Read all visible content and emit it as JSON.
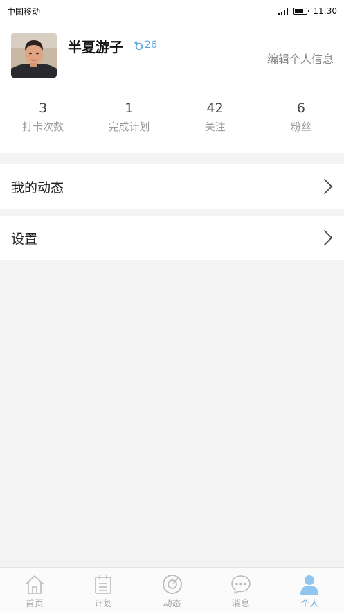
{
  "status_bar": {
    "carrier": "中国移动",
    "time": "11:30"
  },
  "profile": {
    "name": "半夏游子",
    "level": "26",
    "edit_label": "编辑个人信息",
    "stats": [
      {
        "value": "3",
        "label": "打卡次数"
      },
      {
        "value": "1",
        "label": "完成计划"
      },
      {
        "value": "42",
        "label": "关注"
      },
      {
        "value": "6",
        "label": "粉丝"
      }
    ]
  },
  "menu": [
    {
      "label": "我的动态",
      "icon": "chevron-right-icon"
    },
    {
      "label": "设置",
      "icon": "chevron-right-icon"
    }
  ],
  "tabs": [
    {
      "label": "首页",
      "icon": "home-icon",
      "active": false
    },
    {
      "label": "计划",
      "icon": "calendar-icon",
      "active": false
    },
    {
      "label": "动态",
      "icon": "dynamic-icon",
      "active": false
    },
    {
      "label": "消息",
      "icon": "message-icon",
      "active": false
    },
    {
      "label": "个人",
      "icon": "person-icon",
      "active": true
    }
  ],
  "colors": {
    "accent": "#5aa7e0",
    "inactive": "#aaaaaa",
    "background": "#f3f3f3"
  }
}
